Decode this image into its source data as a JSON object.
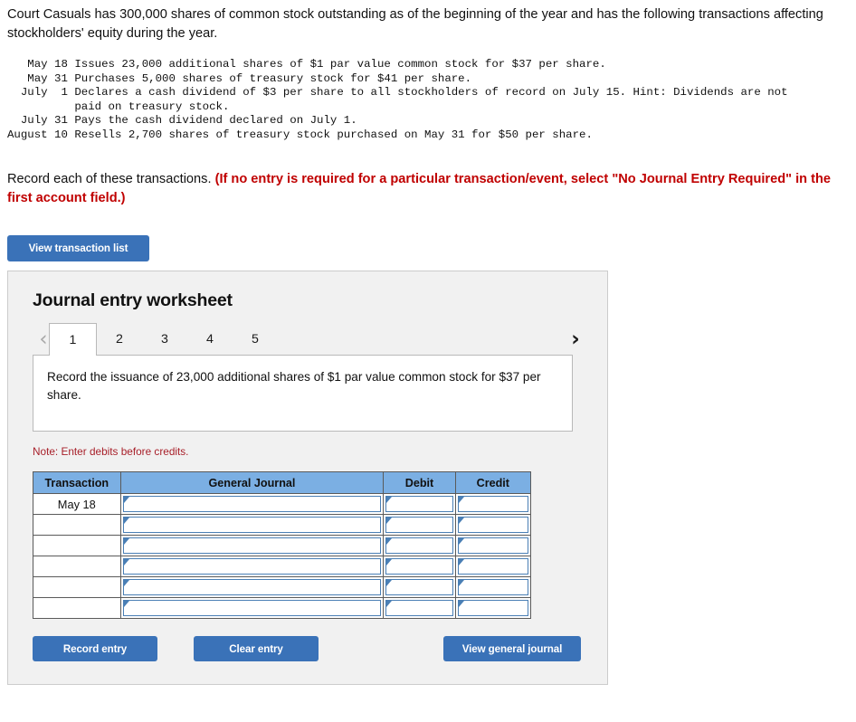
{
  "intro": {
    "paragraph": "Court Casuals has 300,000 shares of common stock outstanding as of the beginning of the year and has the following transactions affecting stockholders' equity during the year."
  },
  "transaction_list": {
    "lines": [
      "   May 18 Issues 23,000 additional shares of $1 par value common stock for $37 per share.",
      "   May 31 Purchases 5,000 shares of treasury stock for $41 per share.",
      "  July  1 Declares a cash dividend of $3 per share to all stockholders of record on July 15. Hint: Dividends are not",
      "          paid on treasury stock.",
      "  July 31 Pays the cash dividend declared on July 1.",
      "August 10 Resells 2,700 shares of treasury stock purchased on May 31 for $50 per share."
    ]
  },
  "instruction": {
    "lead": "Record each of these transactions. ",
    "highlight": "(If no entry is required for a particular transaction/event, select \"No Journal Entry Required\" in the first account field.)"
  },
  "buttons": {
    "view_transaction_list": "View transaction list",
    "record_entry": "Record entry",
    "clear_entry": "Clear entry",
    "view_general_journal": "View general journal"
  },
  "worksheet": {
    "title": "Journal entry worksheet",
    "prev_icon": "‹",
    "next_icon": "›",
    "tabs": [
      {
        "label": "1",
        "active": true
      },
      {
        "label": "2",
        "active": false
      },
      {
        "label": "3",
        "active": false
      },
      {
        "label": "4",
        "active": false
      },
      {
        "label": "5",
        "active": false
      }
    ],
    "description": "Record the issuance of 23,000 additional shares of $1 par value common stock for $37 per share.",
    "note": "Note: Enter debits before credits."
  },
  "journal_table": {
    "headers": [
      "Transaction",
      "General Journal",
      "Debit",
      "Credit"
    ],
    "rows": [
      {
        "transaction": "May 18",
        "general_journal": "",
        "debit": "",
        "credit": ""
      },
      {
        "transaction": "",
        "general_journal": "",
        "debit": "",
        "credit": ""
      },
      {
        "transaction": "",
        "general_journal": "",
        "debit": "",
        "credit": ""
      },
      {
        "transaction": "",
        "general_journal": "",
        "debit": "",
        "credit": ""
      },
      {
        "transaction": "",
        "general_journal": "",
        "debit": "",
        "credit": ""
      },
      {
        "transaction": "",
        "general_journal": "",
        "debit": "",
        "credit": ""
      }
    ]
  },
  "colors": {
    "button_blue": "#3a72b8",
    "table_header_blue": "#7bafe3",
    "field_border_blue": "#4a7fb5",
    "note_red": "#a8202a",
    "highlight_red": "#c00000",
    "panel_gray": "#f1f1f1"
  }
}
